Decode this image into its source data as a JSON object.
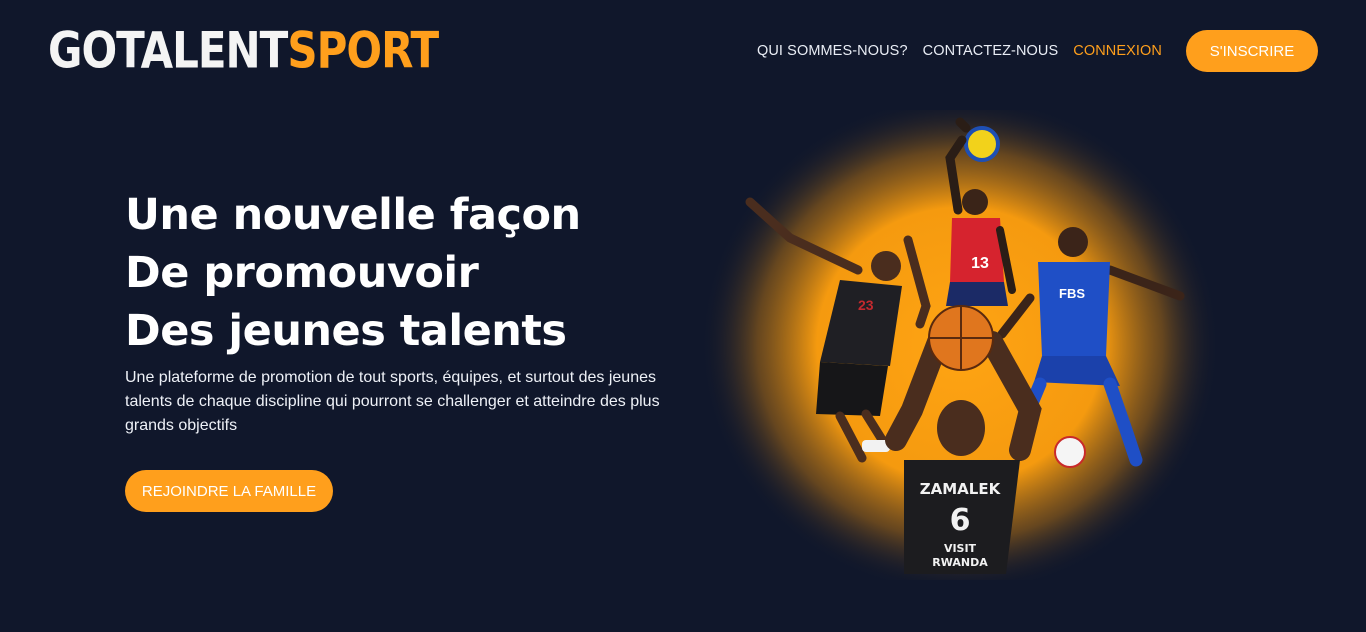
{
  "brand": {
    "part1": "GOTALENT",
    "part2": "SPORT",
    "primary_color": "#ff9f1c",
    "background": "#10172b"
  },
  "nav": {
    "items": [
      {
        "label": "QUI SOMMES-NOUS?"
      },
      {
        "label": "CONTACTEZ-NOUS"
      },
      {
        "label": "CONNEXION"
      }
    ],
    "signup_label": "S'INSCRIRE"
  },
  "hero": {
    "title_lines": [
      "Une nouvelle façon",
      "De promouvoir",
      "Des jeunes talents"
    ],
    "subtitle": "Une plateforme de promotion de tout sports, équipes, et surtout des jeunes talents de chaque discipline qui pourront se challenger et atteindre des plus grands objectifs",
    "cta_label": "REJOINDRE LA FAMILLE"
  },
  "image": {
    "jerseys": {
      "volleyball_number": "13",
      "footballer_sponsor": "FBS",
      "basketball_team": "ZAMALEK",
      "basketball_number": "6",
      "basketball_sponsor_line1": "VISIT",
      "basketball_sponsor_line2": "RWANDA"
    }
  }
}
